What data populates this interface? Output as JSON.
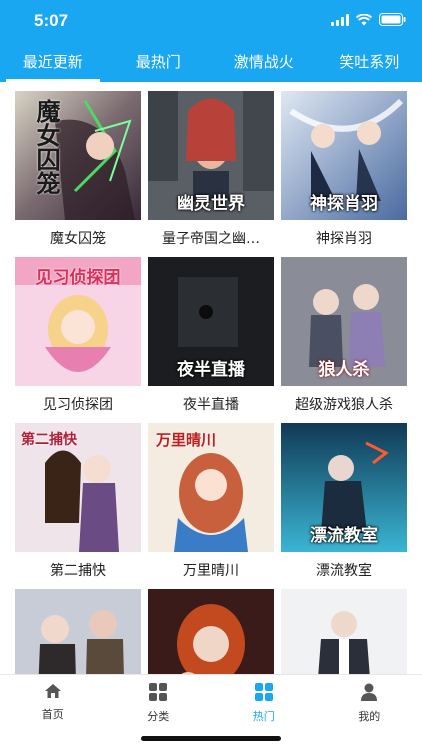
{
  "status_bar": {
    "time": "5:07"
  },
  "tabs": [
    "最近更新",
    "最热门",
    "激情战火",
    "笑吐系列"
  ],
  "comics": [
    {
      "title": "魔女囚笼",
      "cover_text": "魔女囚笼"
    },
    {
      "title": "量子帝国之幽…",
      "cover_text": "幽灵世界"
    },
    {
      "title": "神探肖羽",
      "cover_text": "神探肖羽"
    },
    {
      "title": "见习侦探团",
      "cover_text": "见习侦探团"
    },
    {
      "title": "夜半直播",
      "cover_text": "夜半直播"
    },
    {
      "title": "超级游戏狼人杀",
      "cover_text": "狼人杀"
    },
    {
      "title": "第二捕快",
      "cover_text": "第二捕快"
    },
    {
      "title": "万里晴川",
      "cover_text": "万里晴川"
    },
    {
      "title": "漂流教室",
      "cover_text": "漂流教室"
    },
    {
      "title": "",
      "cover_text": ""
    },
    {
      "title": "",
      "cover_text": ""
    },
    {
      "title": "",
      "cover_text": ""
    }
  ],
  "bottom_nav": [
    {
      "label": "首页",
      "icon": "home-icon"
    },
    {
      "label": "分类",
      "icon": "grid-icon"
    },
    {
      "label": "热门",
      "icon": "hot-grid-icon"
    },
    {
      "label": "我的",
      "icon": "person-icon"
    }
  ],
  "colors": {
    "accent": "#1aa7f2",
    "text": "#222222"
  }
}
